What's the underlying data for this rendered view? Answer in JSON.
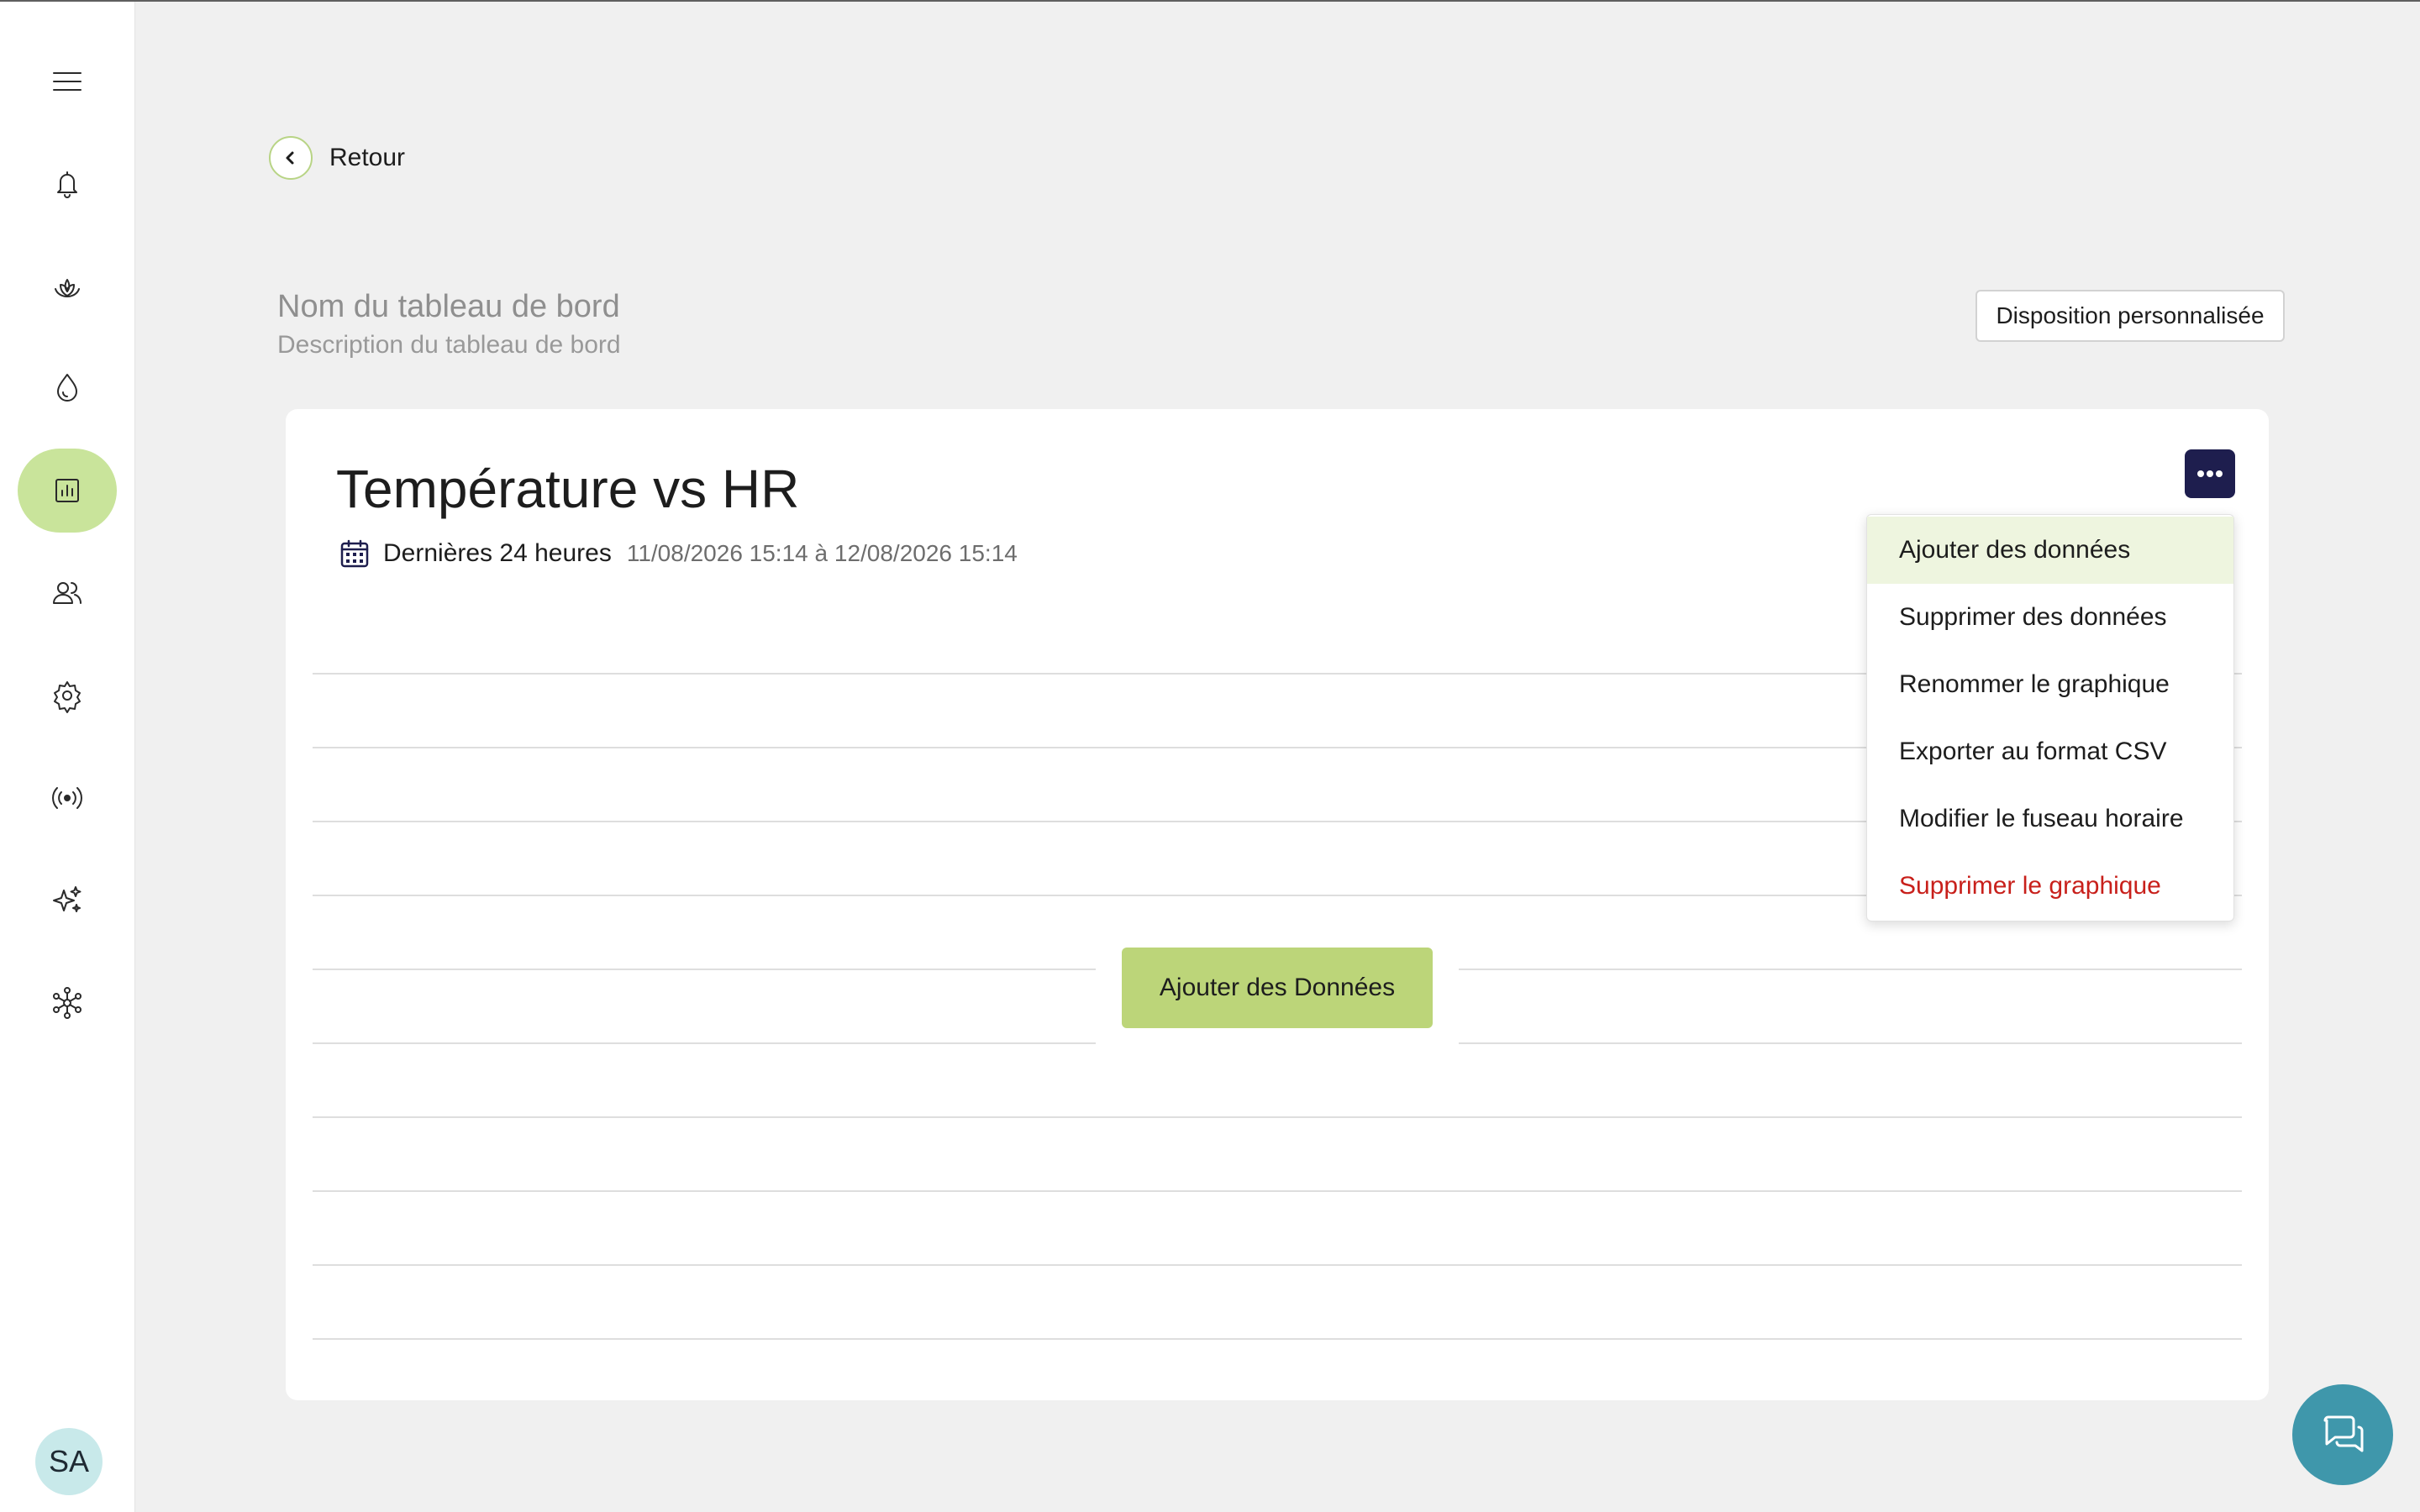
{
  "back": {
    "label": "Retour"
  },
  "dashboard": {
    "name": "Nom du tableau de bord",
    "description": "Description du tableau de bord",
    "layout_button": "Disposition personnalisée"
  },
  "chart": {
    "title": "Température vs HR",
    "range_label": "Dernières 24 heures",
    "range_dates": "11/08/2026 15:14 à 12/08/2026 15:14",
    "add_data_button": "Ajouter des Données"
  },
  "menu": {
    "items": [
      {
        "label": "Ajouter des données"
      },
      {
        "label": "Supprimer des données"
      },
      {
        "label": "Renommer le graphique"
      },
      {
        "label": "Exporter au format CSV"
      },
      {
        "label": "Modifier le fuseau horaire"
      },
      {
        "label": "Supprimer le graphique"
      }
    ]
  },
  "user": {
    "initials": "SA"
  },
  "colors": {
    "accent_green": "#c9e49b",
    "button_green": "#bcd579",
    "navy": "#1e1e4e",
    "danger_red": "#c8201b",
    "chat_teal": "#3f97ab"
  },
  "icons": {
    "sidebar": [
      "menu-icon",
      "bell-icon",
      "plant-icon",
      "water-drop-icon",
      "chart-icon",
      "users-icon",
      "gear-icon",
      "broadcast-icon",
      "sparkles-icon",
      "network-icon"
    ],
    "other": [
      "chevron-left-icon",
      "calendar-icon",
      "more-icon",
      "chat-icon"
    ]
  }
}
